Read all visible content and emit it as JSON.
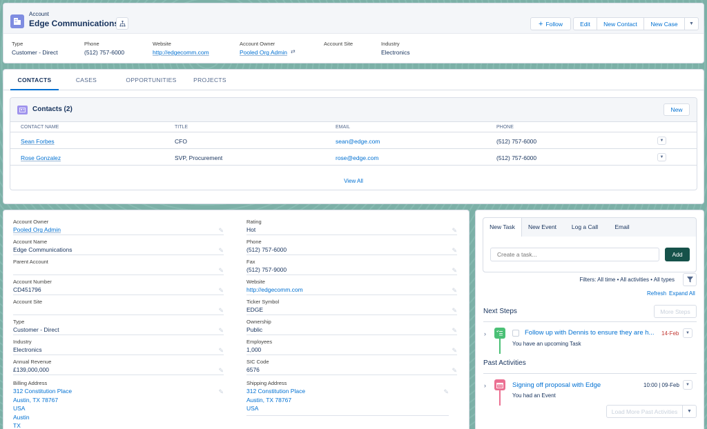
{
  "header": {
    "object_label": "Account",
    "title": "Edge Communications",
    "buttons": {
      "follow": "Follow",
      "edit": "Edit",
      "new_contact": "New Contact",
      "new_case": "New Case"
    },
    "fields": [
      {
        "label": "Type",
        "value": "Customer - Direct"
      },
      {
        "label": "Phone",
        "value": "(512) 757-6000"
      },
      {
        "label": "Website",
        "value": "http://edgecomm.com"
      },
      {
        "label": "Account Owner",
        "value": "Pooled Org Admin"
      },
      {
        "label": "Account Site",
        "value": ""
      },
      {
        "label": "Industry",
        "value": "Electronics"
      }
    ]
  },
  "tabs": [
    "CONTACTS",
    "CASES",
    "OPPORTUNITIES",
    "PROJECTS"
  ],
  "contacts": {
    "title": "Contacts (2)",
    "new_label": "New",
    "view_all": "View All",
    "columns": [
      "CONTACT NAME",
      "TITLE",
      "EMAIL",
      "PHONE"
    ],
    "rows": [
      {
        "name": "Sean Forbes",
        "title": "CFO",
        "email": "sean@edge.com",
        "phone": "(512) 757-6000"
      },
      {
        "name": "Rose Gonzalez",
        "title": "SVP, Procurement",
        "email": "rose@edge.com",
        "phone": "(512) 757-6000"
      }
    ]
  },
  "details": {
    "left": [
      {
        "label": "Account Owner",
        "value": "Pooled Org Admin"
      },
      {
        "label": "Account Name",
        "value": "Edge Communications"
      },
      {
        "label": "Parent Account",
        "value": ""
      },
      {
        "label": "Account Number",
        "value": "CD451796"
      },
      {
        "label": "Account Site",
        "value": ""
      },
      {
        "label": "Type",
        "value": "Customer - Direct"
      },
      {
        "label": "Industry",
        "value": "Electronics"
      },
      {
        "label": "Annual Revenue",
        "value": "£139,000,000"
      }
    ],
    "right": [
      {
        "label": "Rating",
        "value": "Hot"
      },
      {
        "label": "Phone",
        "value": "(512) 757-6000"
      },
      {
        "label": "Fax",
        "value": "(512) 757-9000"
      },
      {
        "label": "Website",
        "value": "http://edgecomm.com"
      },
      {
        "label": "Ticker Symbol",
        "value": "EDGE"
      },
      {
        "label": "Ownership",
        "value": "Public"
      },
      {
        "label": "Employees",
        "value": "1,000"
      },
      {
        "label": "SIC Code",
        "value": "6576"
      }
    ],
    "billing": {
      "label": "Billing Address",
      "lines": [
        "312 Constitution Place",
        "Austin, TX 78767",
        "USA",
        "Austin",
        "TX"
      ]
    },
    "shipping": {
      "label": "Shipping Address",
      "lines": [
        "312 Constitution Place",
        "Austin, TX 78767",
        "USA"
      ]
    }
  },
  "activity": {
    "tabs": [
      "New Task",
      "New Event",
      "Log a Call",
      "Email"
    ],
    "task_placeholder": "Create a task...",
    "add_label": "Add",
    "filters": "Filters: All time • All activities • All types",
    "refresh": "Refresh",
    "expand_all": "Expand All",
    "next_steps": "Next Steps",
    "more_steps": "More Steps",
    "task": {
      "title": "Follow up with Dennis to ensure they are h...",
      "date": "14-Feb",
      "sub": "You have an upcoming Task"
    },
    "past": "Past Activities",
    "event": {
      "title": "Signing off proposal with Edge",
      "date": "10:00 | 09-Feb",
      "sub": "You had an Event"
    },
    "load_more": "Load More Past Activities"
  },
  "colors": {
    "accent": "#0070d2",
    "account_icon": "#7f8de1",
    "task_icon": "#4bc076",
    "event_icon": "#eb7092",
    "add_button": "#16524a",
    "overdue": "#c23934"
  }
}
